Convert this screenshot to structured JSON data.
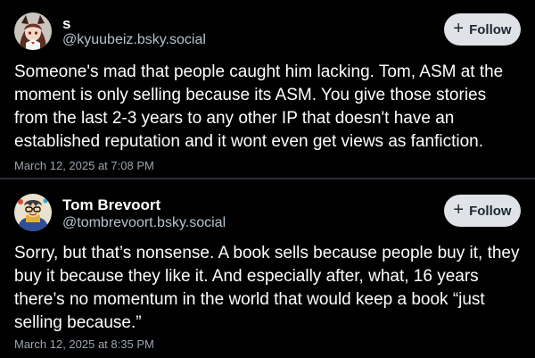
{
  "posts": [
    {
      "display_name": "s",
      "handle": "@kyuubeiz.bsky.social",
      "follow_label": "Follow",
      "follow_icon": "plus-icon",
      "text": "Someone's mad that people caught him lacking. Tom, ASM at the moment is only selling because its ASM. You give those stories from the last 2-3 years to any other IP that doesn't have an established reputation and it wont even get views as fanfiction.",
      "timestamp": "March 12, 2025 at 7:08 PM"
    },
    {
      "display_name": "Tom Brevoort",
      "handle": "@tombrevoort.bsky.social",
      "follow_label": "Follow",
      "follow_icon": "plus-icon",
      "text": "Sorry, but that’s nonsense. A book sells because people buy it, they buy it because they like it. And especially after, what, 16 years there’s no momentum in the world that would keep a book “just selling because.”",
      "timestamp": "March 12, 2025 at 8:35 PM"
    }
  ],
  "colors": {
    "background": "#000000",
    "text": "#ffffff",
    "handle": "#b6c2cf",
    "timestamp": "#9aa5b1",
    "button_bg": "#dfe3e8",
    "button_text": "#1c2733",
    "divider": "#2a2f36"
  }
}
